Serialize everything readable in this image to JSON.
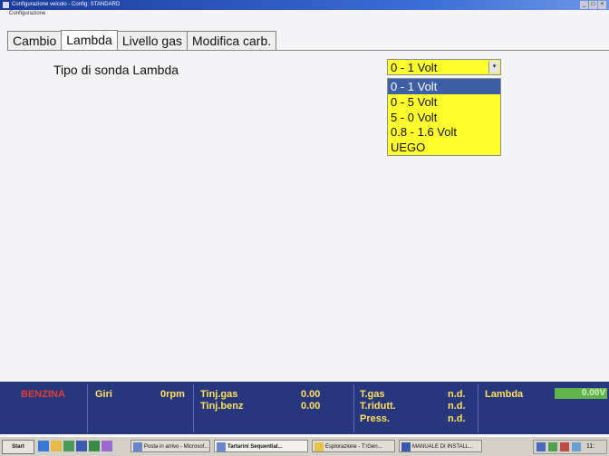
{
  "window": {
    "title": "Configurazione veicolo - Config: STANDARD",
    "menu": "Configurazione",
    "controls": [
      "_",
      "□",
      "×"
    ]
  },
  "tabs": [
    "Cambio",
    "Lambda",
    "Livello gas",
    "Modifica carb."
  ],
  "lambda": {
    "label": "Tipo di sonda Lambda",
    "selected": "0 - 1 Volt",
    "options": [
      "0 - 1 Volt",
      "0 - 5 Volt",
      "5 - 0 Volt",
      "0.8 - 1.6 Volt",
      "UEGO"
    ]
  },
  "status": {
    "mode": "BENZINA",
    "giri_label": "Giri",
    "giri_value": "0rpm",
    "tinj_gas_label": "Tinj.gas",
    "tinj_gas_value": "0.00",
    "tinj_benz_label": "Tinj.benz",
    "tinj_benz_value": "0.00",
    "tgas_label": "T.gas",
    "tgas_value": "n.d.",
    "tridutt_label": "T.ridutt.",
    "tridutt_value": "n.d.",
    "press_label": "Press.",
    "press_value": "n.d.",
    "lambda_label": "Lambda",
    "lambda_value": "0.00V"
  },
  "taskbar": {
    "start": "Start",
    "buttons": [
      "Posta in arrivo - Microsof...",
      "Tartarini Sequential...",
      "Esplorazione - T:\\Gen...",
      "MANUALE DI INSTALL..."
    ],
    "clock": "11:"
  },
  "colors": {
    "highlight_yellow": "#ffff2e",
    "status_bg": "#27377e",
    "status_text": "#ffe15a",
    "benzina_red": "#e23a2e",
    "lambda_green": "#5fb54a"
  }
}
